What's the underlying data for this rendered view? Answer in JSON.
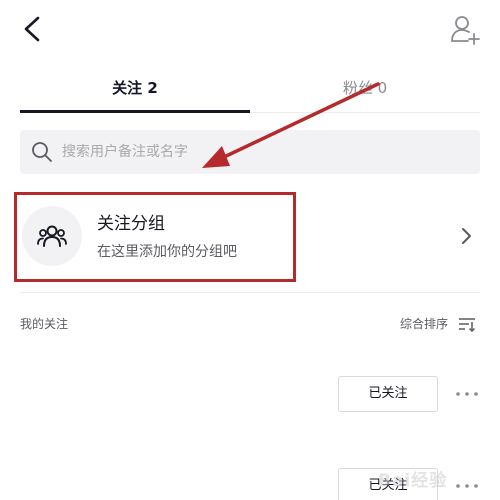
{
  "tabs": [
    {
      "label": "关注 2",
      "active": true
    },
    {
      "label": "粉丝 0",
      "active": false
    }
  ],
  "search": {
    "placeholder": "搜索用户备注或名字",
    "value": ""
  },
  "group": {
    "title": "关注分组",
    "subtitle": "在这里添加你的分组吧"
  },
  "section": {
    "title": "我的关注",
    "sort_label": "综合排序"
  },
  "following_list": [
    {
      "button_label": "已关注"
    },
    {
      "button_label": "已关注"
    }
  ],
  "watermark": "Bai经验",
  "icons": {
    "back": "chevron-left-icon",
    "add_user": "add-user-icon",
    "search": "search-icon",
    "group": "users-icon",
    "chevron": "chevron-right-icon",
    "sort": "sort-icon",
    "more": "more-icon"
  },
  "colors": {
    "text_primary": "#161823",
    "text_secondary": "#5a5b61",
    "placeholder": "#a8a9ad",
    "search_bg": "#f2f2f4",
    "annotation": "#b52a2c"
  }
}
